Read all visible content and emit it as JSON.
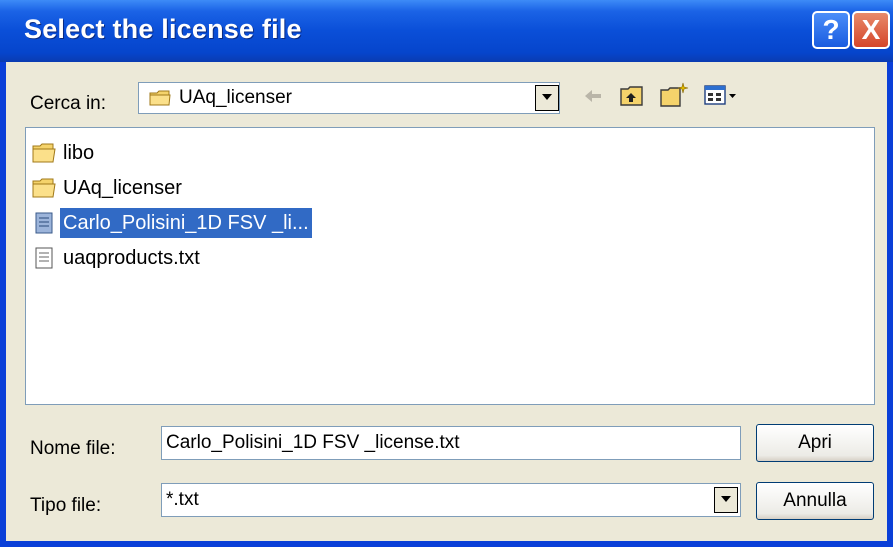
{
  "window": {
    "title": "Select the license file",
    "help_glyph": "?",
    "close_glyph": "X"
  },
  "lookin": {
    "label": "Cerca in:",
    "value": "UAq_licenser",
    "icon": "folder-icon"
  },
  "toolbar": {
    "icons": [
      "back-arrow-icon",
      "up-folder-icon",
      "new-folder-icon",
      "view-menu-icon"
    ]
  },
  "files": [
    {
      "name": "libo",
      "type": "folder",
      "selected": false
    },
    {
      "name": "UAq_licenser",
      "type": "folder",
      "selected": false
    },
    {
      "name": "Carlo_Polisini_1D FSV _li...",
      "type": "text-file",
      "selected": true
    },
    {
      "name": "uaqproducts.txt",
      "type": "text-file",
      "selected": false
    }
  ],
  "filename": {
    "label": "Nome file:",
    "value": "Carlo_Polisini_1D FSV _license.txt"
  },
  "filetype": {
    "label": "Tipo file:",
    "value": "*.txt"
  },
  "buttons": {
    "open": "Apri",
    "cancel": "Annulla"
  },
  "colors": {
    "title_bar": "#0A4FD8",
    "selection": "#316AC5",
    "face": "#ECE9D8"
  }
}
